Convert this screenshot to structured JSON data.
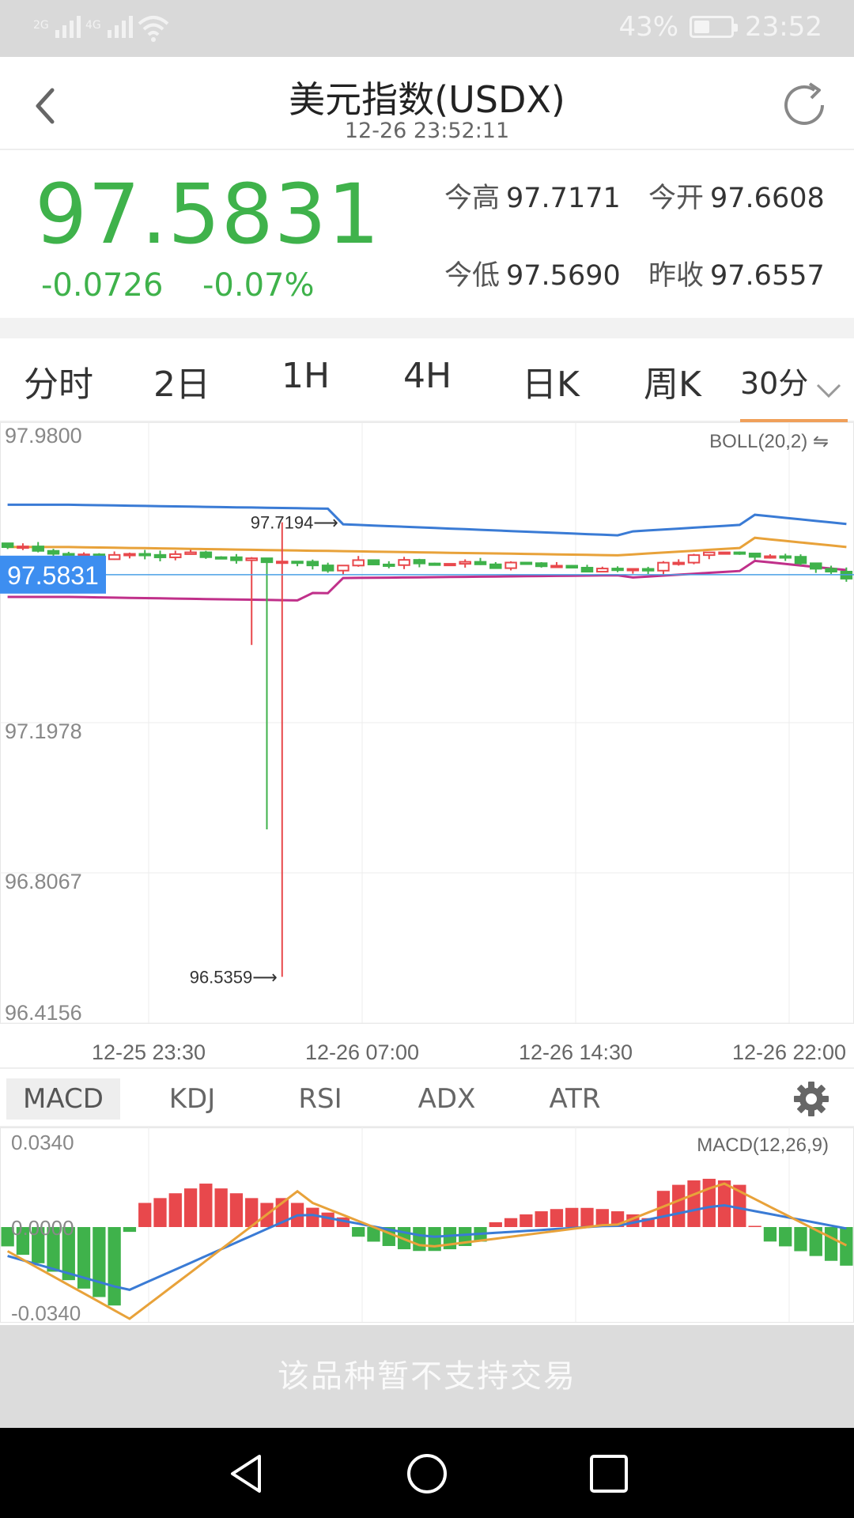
{
  "status_bar": {
    "signal_1": "2G",
    "signal_2": "4G",
    "battery_text": "43%",
    "battery_level": 0.43,
    "time": "23:52"
  },
  "header": {
    "title": "美元指数(USDX)",
    "datetime": "12-26 23:52:11",
    "back_icon": "chevron-left-icon",
    "refresh_icon": "refresh-icon"
  },
  "quote": {
    "price": "97.5831",
    "change": "-0.0726",
    "change_pct": "-0.07%",
    "high_label": "今高",
    "high_value": "97.7171",
    "open_label": "今开",
    "open_value": "97.6608",
    "low_label": "今低",
    "low_value": "97.5690",
    "prev_close_label": "昨收",
    "prev_close_value": "97.6557",
    "color_down": "#3fb24b"
  },
  "period_tabs": [
    "分时",
    "2日",
    "1H",
    "4H",
    "日K",
    "周K"
  ],
  "period_selected": "30分",
  "colors": {
    "up": "#e8484c",
    "down": "#3fb24b",
    "boll_upper": "#3a7bd5",
    "boll_mid": "#e8a23a",
    "boll_lower": "#c0308a",
    "accent": "#f0a05a",
    "price_tag_bg": "#3d8ef0"
  },
  "kchart": {
    "indicator_label": "BOLL(20,2)",
    "y_labels": [
      "97.9800",
      "97.1978",
      "96.8067",
      "96.4156"
    ],
    "x_labels": [
      "12-25 23:30",
      "12-26 07:00",
      "12-26 14:30",
      "12-26 22:00"
    ],
    "current_price_tag": "97.5831",
    "high_annotation": "97.7194",
    "low_annotation": "96.5359"
  },
  "indicator_tabs": [
    "MACD",
    "KDJ",
    "RSI",
    "ADX",
    "ATR"
  ],
  "indicator_selected": "MACD",
  "macd": {
    "label": "MACD(12,26,9)",
    "y_labels": [
      "0.0340",
      "0.0000",
      "-0.0340"
    ]
  },
  "footer_text": "该品种暂不支持交易"
}
